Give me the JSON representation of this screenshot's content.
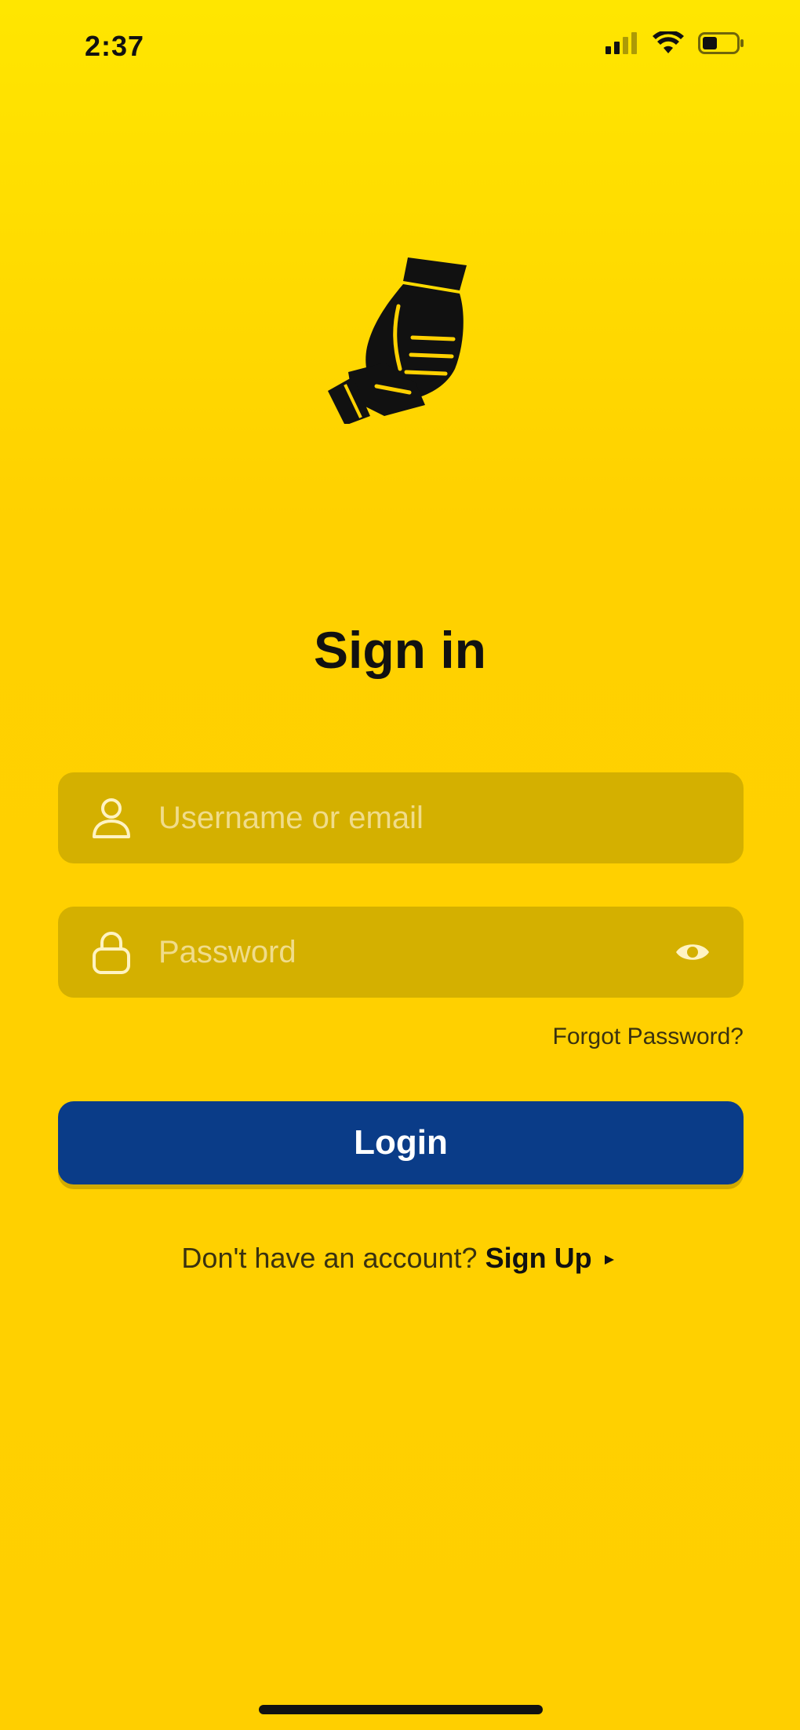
{
  "status_bar": {
    "time": "2:37",
    "icons": [
      "signal-icon",
      "wifi-icon",
      "battery-icon"
    ]
  },
  "logo": {
    "icon": "handshake-logo-icon"
  },
  "title": "Sign in",
  "form": {
    "username": {
      "placeholder": "Username or email",
      "value": "",
      "icon": "user-icon"
    },
    "password": {
      "placeholder": "Password",
      "value": "",
      "icon": "lock-icon",
      "toggle_icon": "eye-icon"
    },
    "forgot_label": "Forgot Password?",
    "login_label": "Login"
  },
  "signup": {
    "prompt": "Don't have an account?",
    "link": "Sign Up",
    "icon": "arrow-icon"
  },
  "colors": {
    "background": "#FFD100",
    "field_bg": "#D4B000",
    "primary_button": "#0A3C88",
    "text": "#111111"
  }
}
